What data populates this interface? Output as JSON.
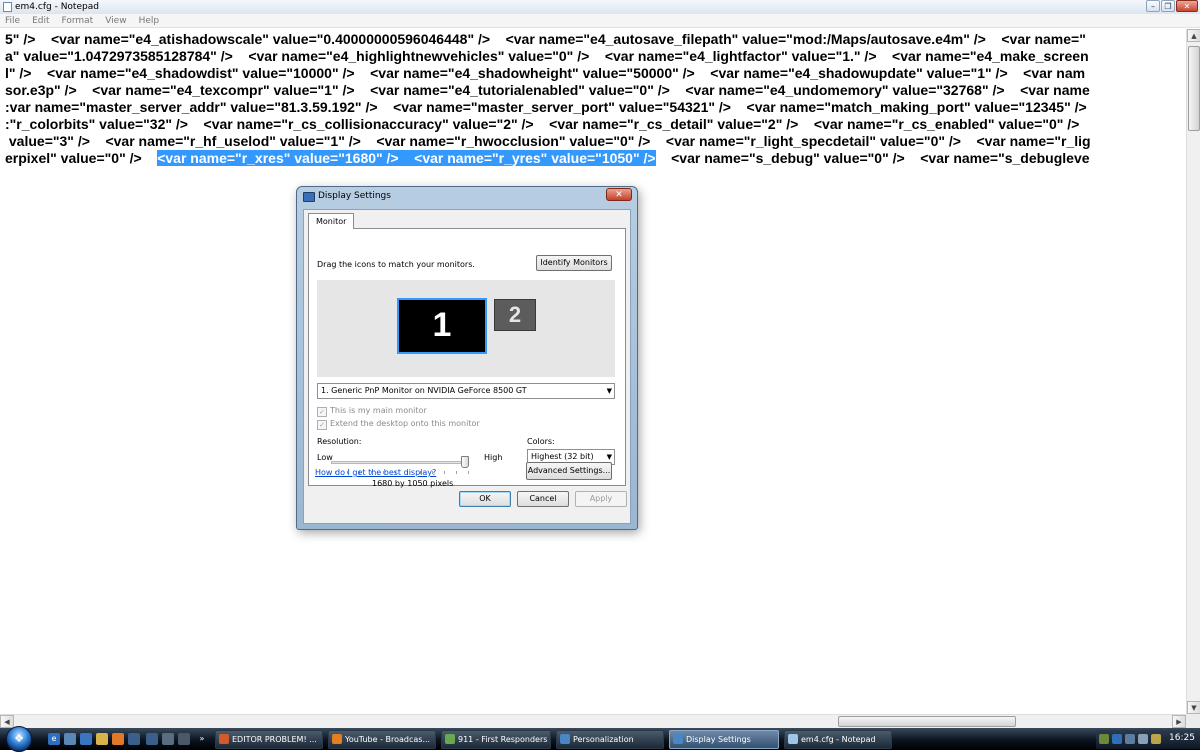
{
  "notepad": {
    "title": "em4.cfg - Notepad",
    "menu": [
      "File",
      "Edit",
      "Format",
      "View",
      "Help"
    ],
    "lines": [
      "5\" />    <var name=\"e4_atishadowscale\" value=\"0.40000000596046448\" />    <var name=\"e4_autosave_filepath\" value=\"mod:/Maps/autosave.e4m\" />    <var name=\"",
      "a\" value=\"1.0472973585128784\" />    <var name=\"e4_highlightnewvehicles\" value=\"0\" />    <var name=\"e4_lightfactor\" value=\"1.\" />    <var name=\"e4_make_screen",
      "l\" />    <var name=\"e4_shadowdist\" value=\"10000\" />    <var name=\"e4_shadowheight\" value=\"50000\" />    <var name=\"e4_shadowupdate\" value=\"1\" />    <var nam",
      "sor.e3p\" />    <var name=\"e4_texcompr\" value=\"1\" />    <var name=\"e4_tutorialenabled\" value=\"0\" />    <var name=\"e4_undomemory\" value=\"32768\" />    <var name",
      ":var name=\"master_server_addr\" value=\"81.3.59.192\" />    <var name=\"master_server_port\" value=\"54321\" />    <var name=\"match_making_port\" value=\"12345\" />",
      ":\"r_colorbits\" value=\"32\" />    <var name=\"r_cs_collisionaccuracy\" value=\"2\" />    <var name=\"r_cs_detail\" value=\"2\" />    <var name=\"r_cs_enabled\" value=\"0\" />",
      " value=\"3\" />    <var name=\"r_hf_uselod\" value=\"1\" />    <var name=\"r_hwocclusion\" value=\"0\" />    <var name=\"r_light_specdetail\" value=\"0\" />    <var name=\"r_lig"
    ],
    "last_line": {
      "before": "erpixel\" value=\"0\" />    ",
      "selected": "<var name=\"r_xres\" value=\"1680\" />    <var name=\"r_yres\" value=\"1050\" />",
      "after": "    <var name=\"s_debug\" value=\"0\" />    <var name=\"s_debugleve"
    }
  },
  "dialog": {
    "title": "Display Settings",
    "tab": "Monitor",
    "instruction": "Drag the icons to match your monitors.",
    "identify_button": "Identify Monitors",
    "monitor1_label": "1",
    "monitor2_label": "2",
    "monitor_select": "1. Generic PnP Monitor on NVIDIA GeForce 8500 GT",
    "main_monitor_checkbox": "This is my main monitor",
    "extend_checkbox": "Extend the desktop onto this monitor",
    "resolution_label": "Resolution:",
    "low_label": "Low",
    "high_label": "High",
    "resolution_slider_level": 1.0,
    "resolution_value": "1680 by 1050 pixels",
    "colors_label": "Colors:",
    "colors_select": "Highest (32 bit)",
    "help_link": "How do I get the best display?",
    "advanced_button": "Advanced Settings...",
    "ok_button": "OK",
    "cancel_button": "Cancel",
    "apply_button": "Apply"
  },
  "taskbar": {
    "buttons": [
      {
        "label": "EDITOR PROBLEM! ...",
        "icon_color": "#d35a2a"
      },
      {
        "label": "YouTube - Broadcas...",
        "icon_color": "#e0801e"
      },
      {
        "label": "911 - First Responders",
        "icon_color": "#6aa84f"
      },
      {
        "label": "Personalization",
        "icon_color": "#4a86c6"
      },
      {
        "label": "Display Settings",
        "icon_color": "#4a86c6"
      },
      {
        "label": "em4.cfg - Notepad",
        "icon_color": "#9fc5e8"
      }
    ],
    "clock": "16:25"
  },
  "colors": {
    "selection": "#3399ff",
    "link": "#0046d5",
    "accent_monitor_border": "#3399ff"
  }
}
